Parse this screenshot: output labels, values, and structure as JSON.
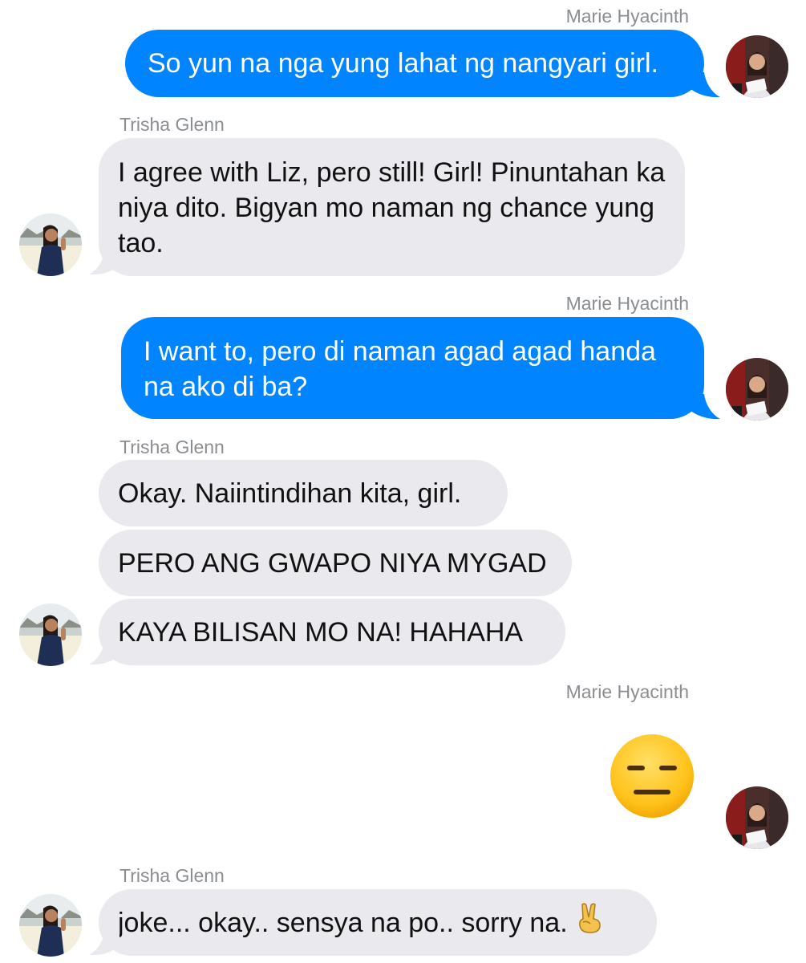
{
  "participants": {
    "me": "Marie Hyacinth",
    "friend": "Trisha Glenn"
  },
  "messages": [
    {
      "sender": "Marie Hyacinth",
      "text": "So yun na nga yung lahat ng nangyari girl."
    },
    {
      "sender": "Trisha Glenn",
      "text": "I agree with Liz, pero still! Girl! Pinuntahan ka niya dito. Bigyan mo naman ng chance yung tao."
    },
    {
      "sender": "Marie Hyacinth",
      "text": "I want to, pero di naman agad agad handa na ako di ba?"
    },
    {
      "sender": "Trisha Glenn",
      "text": "Okay. Naiintindihan kita, girl."
    },
    {
      "sender": "Trisha Glenn",
      "text": "PERO ANG GWAPO NIYA MYGAD"
    },
    {
      "sender": "Trisha Glenn",
      "text": "KAYA BILISAN MO NA! HAHAHA"
    },
    {
      "sender": "Marie Hyacinth",
      "emoji": "expressionless-face"
    },
    {
      "sender": "Trisha Glenn",
      "text": "joke... okay.. sensya na po.. sorry na.",
      "trailing_emoji": "victory-hand"
    }
  ],
  "colors": {
    "outgoing_bubble": "#0084ff",
    "incoming_bubble": "#e9e9ee",
    "sender_name": "#8a8d91"
  }
}
